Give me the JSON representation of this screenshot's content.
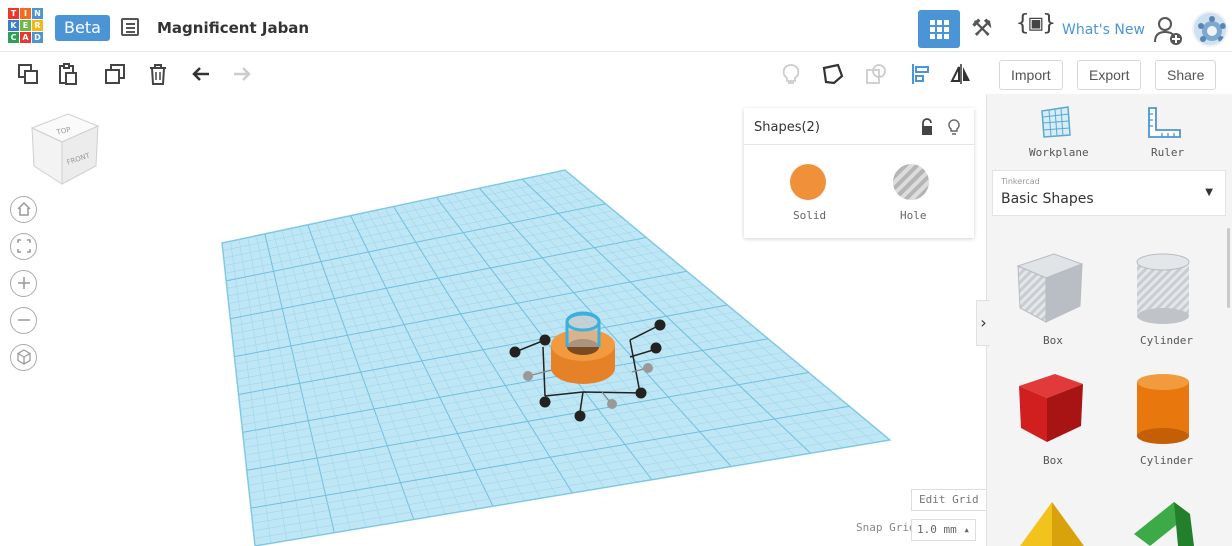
{
  "app": {
    "logo_letters": [
      "T",
      "I",
      "N",
      "K",
      "E",
      "R",
      "C",
      "A",
      "D"
    ],
    "beta_label": "Beta",
    "design_title": "Magnificent Jaban",
    "whats_new_label": "What's New"
  },
  "toolbar": {
    "import_label": "Import",
    "export_label": "Export",
    "share_label": "Share"
  },
  "viewcube": {
    "top_label": "TOP",
    "front_label": "FRONT"
  },
  "shapes_panel": {
    "title": "Shapes(2)",
    "solid_label": "Solid",
    "hole_label": "Hole"
  },
  "grid_controls": {
    "edit_grid_label": "Edit Grid",
    "snap_grid_label": "Snap Grid",
    "snap_value": "1.0 mm ▴"
  },
  "right_panel": {
    "workplane_label": "Workplane",
    "ruler_label": "Ruler",
    "library_small": "Tinkercad",
    "library_value": "Basic Shapes",
    "shapes": [
      {
        "label": "Box"
      },
      {
        "label": "Cylinder"
      },
      {
        "label": "Box"
      },
      {
        "label": "Cylinder"
      }
    ]
  },
  "colors": {
    "accent": "#4b95d6",
    "solid_orange": "#f0903a",
    "grid_blue": "#a9dcef",
    "red_box": "#d42020",
    "orange_cylinder": "#e8780e"
  }
}
